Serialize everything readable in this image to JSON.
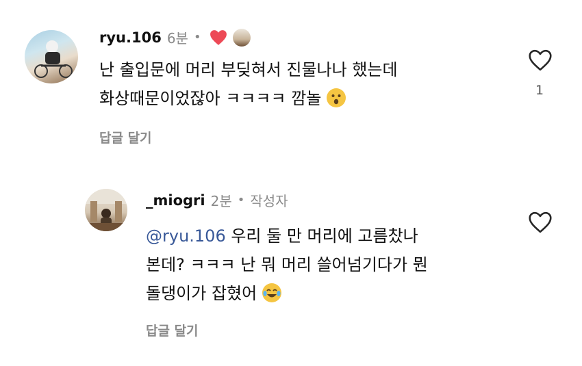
{
  "comments": [
    {
      "username": "ryu.106",
      "time": "6분",
      "separator": "•",
      "text_line1": "난 출입문에 머리 부딪혀서 진물나나 했는데",
      "text_line2": "화상때문이었잖아 ㅋㅋㅋㅋ 깜놀",
      "emoji": "surprised-face",
      "reply_label": "답글 달기",
      "like_count": "1",
      "liked_by_author": true
    },
    {
      "username": "_miogri",
      "time": "2분",
      "separator": "•",
      "author_badge": "작성자",
      "mention": "@ryu.106",
      "text_line1": " 우리 둘 만 머리에 고름찼나",
      "text_line2": "본데? ㅋㅋㅋ 난 뭐 머리 쓸어넘기다가 뭔",
      "text_line3": "돌댕이가 잡혔어",
      "emoji": "laughing-tears-face",
      "reply_label": "답글 달기"
    }
  ],
  "colors": {
    "heart_red": "#ed4956",
    "mention": "#385898",
    "meta_gray": "#8a8a8a",
    "emoji_yellow": "#f5c542"
  }
}
